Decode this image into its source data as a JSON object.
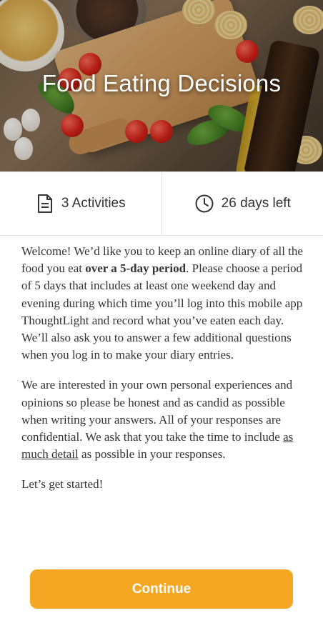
{
  "header": {
    "title": "Food Eating Decisions"
  },
  "stats": {
    "activities": {
      "icon": "document-icon",
      "label": "3 Activities"
    },
    "time_left": {
      "icon": "clock-icon",
      "label": "26 days left"
    }
  },
  "intro": {
    "p1": {
      "a": "Welcome! We’d like you to keep an online diary of all the food you eat ",
      "b": "over a 5-day period",
      "c": ".  Please choose a period of 5 days that includes at least one weekend day and evening during which time you’ll log into this mobile app ThoughtLight and record what you’ve eaten each day.  We’ll also ask you to answer a few additional questions when you log in to make your diary entries."
    },
    "p2": {
      "a": "We are interested in your own personal experiences and opinions so please be honest and as candid as possible when writing your answers. All of your responses are confidential. We ask that you take the time to include ",
      "b": "as much detail",
      "c": " as possible in your responses."
    },
    "p3": "Let’s get started!"
  },
  "actions": {
    "continue_label": "Continue"
  },
  "colors": {
    "accent": "#f5a623",
    "text": "#333333",
    "divider": "#e2e2e2"
  }
}
